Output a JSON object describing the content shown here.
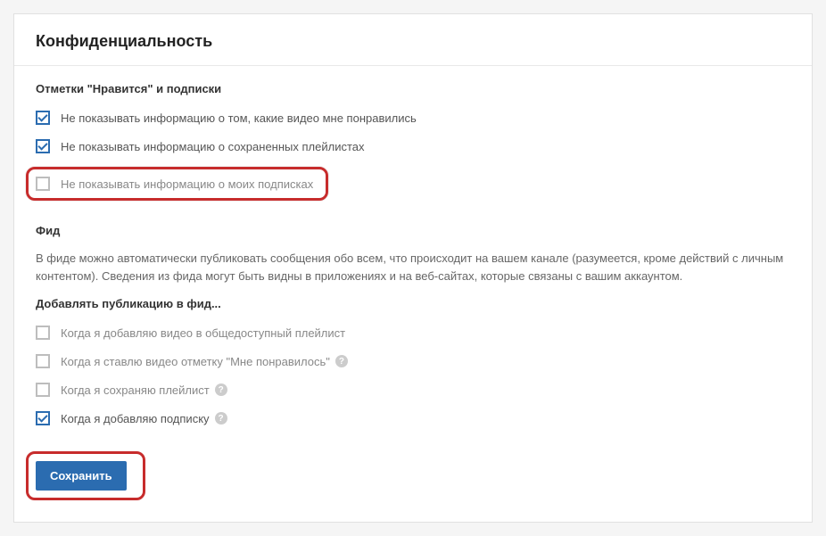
{
  "header": {
    "title": "Конфиденциальность"
  },
  "likes_subs": {
    "title": "Отметки \"Нравится\" и подписки",
    "opt1": "Не показывать информацию о том, какие видео мне понравились",
    "opt2": "Не показывать информацию о сохраненных плейлистах",
    "opt3": "Не показывать информацию о моих подписках"
  },
  "feed": {
    "title": "Фид",
    "description": "В фиде можно автоматически публиковать сообщения обо всем, что происходит на вашем канале (разумеется, кроме действий с личным контентом). Сведения из фида могут быть видны в приложениях и на веб-сайтах, которые связаны с вашим аккаунтом.",
    "subtitle": "Добавлять публикацию в фид...",
    "opt1": "Когда я добавляю видео в общедоступный плейлист",
    "opt2": "Когда я ставлю видео отметку \"Мне понравилось\"",
    "opt3": "Когда я сохраняю плейлист",
    "opt4": "Когда я добавляю подписку"
  },
  "actions": {
    "save": "Сохранить"
  },
  "help_glyph": "?"
}
